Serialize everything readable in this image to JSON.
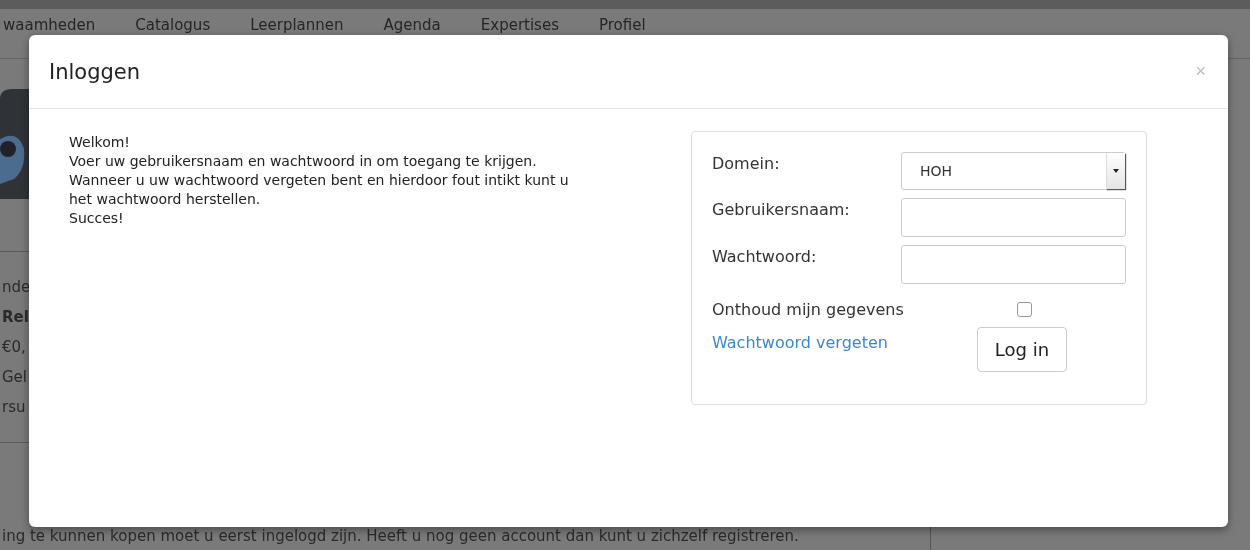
{
  "nav": {
    "items": [
      {
        "label": "waamheden"
      },
      {
        "label": "Catalogus"
      },
      {
        "label": "Leerplannen"
      },
      {
        "label": "Agenda"
      },
      {
        "label": "Expertises"
      },
      {
        "label": "Profiel"
      }
    ]
  },
  "side_fragments": [
    {
      "text": "nde",
      "bold": false
    },
    {
      "text": "Rel",
      "bold": true
    },
    {
      "text": "€0,",
      "bold": false
    },
    {
      "text": "Gel",
      "bold": false
    },
    {
      "text": "rsu",
      "bold": false
    }
  ],
  "footer_text": "ing te kunnen kopen moet u eerst ingelogd zijn. Heeft u nog geen account dan kunt u zichzelf registreren.",
  "modal": {
    "title": "Inloggen",
    "close": "×",
    "intro": [
      "Welkom!",
      "Voer uw gebruikersnaam en wachtwoord in om toegang te krijgen. Wanneer u uw wachtwoord vergeten bent en hierdoor fout intikt kunt u het wachtwoord herstellen.",
      "Succes!"
    ],
    "fields": [
      {
        "kind": "select",
        "label": "Domein:",
        "value": "HOH"
      },
      {
        "kind": "text",
        "label": "Gebruikersnaam:"
      },
      {
        "kind": "password",
        "label": "Wachtwoord:"
      }
    ],
    "remember": {
      "label": "Onthoud mijn gegevens",
      "checked": false
    },
    "forgot_link": "Wachtwoord vergeten",
    "submit": "Log in"
  }
}
